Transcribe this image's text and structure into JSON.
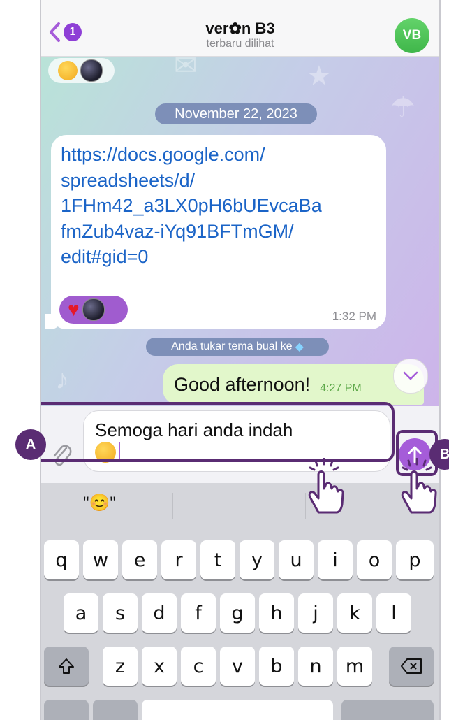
{
  "header": {
    "back_badge": "1",
    "title": "ver✿n B3",
    "subtitle": "terbaru dilihat",
    "avatar_initials": "VB"
  },
  "chat": {
    "date": "November 22, 2023",
    "link_message": "https://docs.google.com/\nspreadsheets/d/\n1FHm42_a3LX0pH6bUEvcaBa\nfmZub4vaz-iYq91BFTmGM/\nedit#gid=0",
    "link_time": "1:32 PM",
    "system_notice": "Anda tukar tema bual ke",
    "outgoing_text": "Good afternoon!",
    "outgoing_time": "4:27 PM"
  },
  "input": {
    "text": "Semoga hari anda indah",
    "emoji_name": "smiling-face-emoji"
  },
  "annotations": {
    "a": "A",
    "b": "B"
  },
  "suggestions": {
    "first": "\"😊\""
  },
  "keyboard": {
    "row1": [
      "q",
      "w",
      "e",
      "r",
      "t",
      "y",
      "u",
      "i",
      "o",
      "p"
    ],
    "row2": [
      "a",
      "s",
      "d",
      "f",
      "g",
      "h",
      "j",
      "k",
      "l"
    ],
    "row3": [
      "z",
      "x",
      "c",
      "v",
      "b",
      "n",
      "m"
    ],
    "shift_icon": "shift-icon",
    "backspace_icon": "backspace-icon"
  },
  "colors": {
    "accent": "#a55cd9",
    "annotation": "#5a2c73",
    "link": "#1b64c7",
    "outgoing_bubble": "#e2f7cb"
  }
}
